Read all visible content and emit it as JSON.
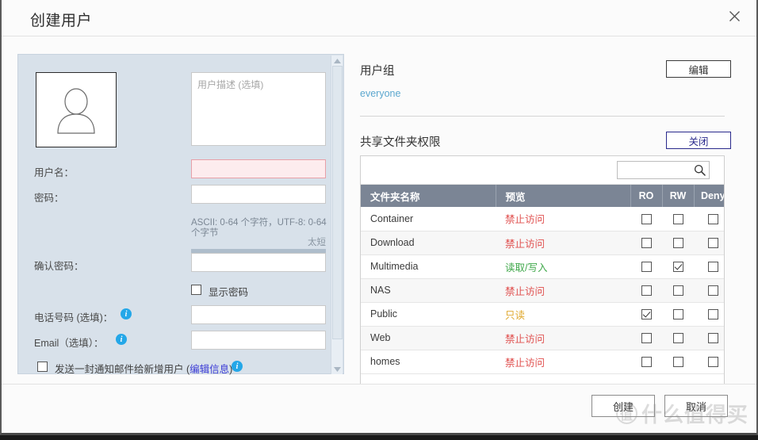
{
  "window": {
    "title": "创建用户",
    "close_icon": "close-icon"
  },
  "form": {
    "avatar_icon": "user-avatar-icon",
    "description_placeholder": "用户描述 (选填)",
    "description_value": "",
    "fields": [
      {
        "label": "用户名：",
        "value": "",
        "state": "error"
      },
      {
        "label": "密码：",
        "value": "",
        "state": "normal"
      },
      {
        "label": "确认密码：",
        "value": "",
        "state": "normal"
      },
      {
        "label": "电话号码 (选填)：",
        "value": "",
        "state": "normal",
        "info": true
      },
      {
        "label": "Email（选填）：",
        "value": "",
        "state": "normal",
        "info": true
      }
    ],
    "password_hint": "ASCII: 0-64 个字符，UTF-8: 0-64 个字节",
    "strength_label": "太短",
    "show_password_label": "显示密码",
    "show_password_checked": false,
    "notify_prefix": "发送一封通知邮件给新增用户 (",
    "notify_link": "编辑信息",
    "notify_suffix": ")",
    "notify_checked": false,
    "scrollbar": {
      "up_icon": "scroll-up-arrow-icon",
      "down_icon": "scroll-down-arrow-icon"
    }
  },
  "groups": {
    "title": "用户组",
    "edit_label": "编辑",
    "member": "everyone"
  },
  "permissions": {
    "title": "共享文件夹权限",
    "close_label": "关闭",
    "search_placeholder": "",
    "search_value": "",
    "search_icon": "search-icon",
    "columns": [
      "文件夹名称",
      "预览",
      "RO",
      "RW",
      "Deny"
    ],
    "rows": [
      {
        "name": "Container",
        "preview": "禁止访问",
        "preview_kind": "deny",
        "ro": false,
        "rw": false,
        "deny": false
      },
      {
        "name": "Download",
        "preview": "禁止访问",
        "preview_kind": "deny",
        "ro": false,
        "rw": false,
        "deny": false
      },
      {
        "name": "Multimedia",
        "preview": "读取/写入",
        "preview_kind": "rw",
        "ro": false,
        "rw": true,
        "deny": false
      },
      {
        "name": "NAS",
        "preview": "禁止访问",
        "preview_kind": "deny",
        "ro": false,
        "rw": false,
        "deny": false
      },
      {
        "name": "Public",
        "preview": "只读",
        "preview_kind": "ro",
        "ro": true,
        "rw": false,
        "deny": false
      },
      {
        "name": "Web",
        "preview": "禁止访问",
        "preview_kind": "deny",
        "ro": false,
        "rw": false,
        "deny": false
      },
      {
        "name": "homes",
        "preview": "禁止访问",
        "preview_kind": "deny",
        "ro": false,
        "rw": false,
        "deny": false
      }
    ]
  },
  "footer": {
    "create_label": "创建",
    "cancel_label": "取消"
  },
  "watermark": {
    "mark": "值",
    "text": "什么值得买"
  },
  "colors": {
    "panel_bg": "#d8e1ea",
    "table_header": "#7b8595",
    "link": "#5ba7cf",
    "deny": "#e0504f",
    "rw": "#3fa84a",
    "ro": "#e0a92f",
    "info": "#24a7e8",
    "error_field": "#fdecee"
  }
}
